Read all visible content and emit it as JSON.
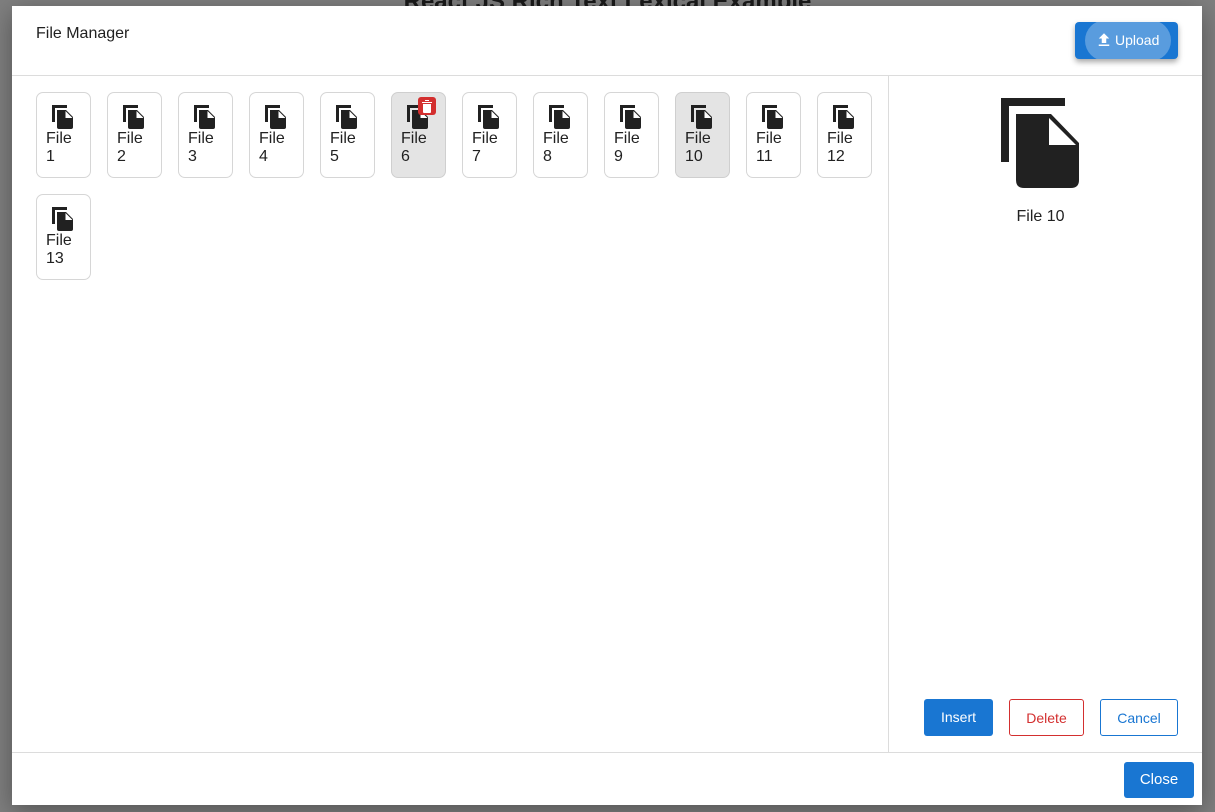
{
  "background": {
    "title": "React JS Rich Text Lexical Example"
  },
  "modal": {
    "title": "File Manager",
    "upload_label": "Upload"
  },
  "files": [
    {
      "label": "File 1"
    },
    {
      "label": "File 2"
    },
    {
      "label": "File 3"
    },
    {
      "label": "File 4"
    },
    {
      "label": "File 5"
    },
    {
      "label": "File 6",
      "hovered": true
    },
    {
      "label": "File 7"
    },
    {
      "label": "File 8"
    },
    {
      "label": "File 9"
    },
    {
      "label": "File 10",
      "selected": true
    },
    {
      "label": "File 11"
    },
    {
      "label": "File 12"
    },
    {
      "label": "File 13"
    }
  ],
  "preview": {
    "name": "File 10"
  },
  "actions": {
    "insert_label": "Insert",
    "delete_label": "Delete",
    "cancel_label": "Cancel"
  },
  "footer": {
    "close_label": "Close"
  },
  "colors": {
    "primary": "#1976d2",
    "danger": "#d32f2f",
    "selected_tile": "#e4e4e4",
    "overlay": "#7f7f7f"
  },
  "icons": {
    "file": "file-copy-icon",
    "upload": "upload-icon",
    "delete": "trash-icon"
  }
}
